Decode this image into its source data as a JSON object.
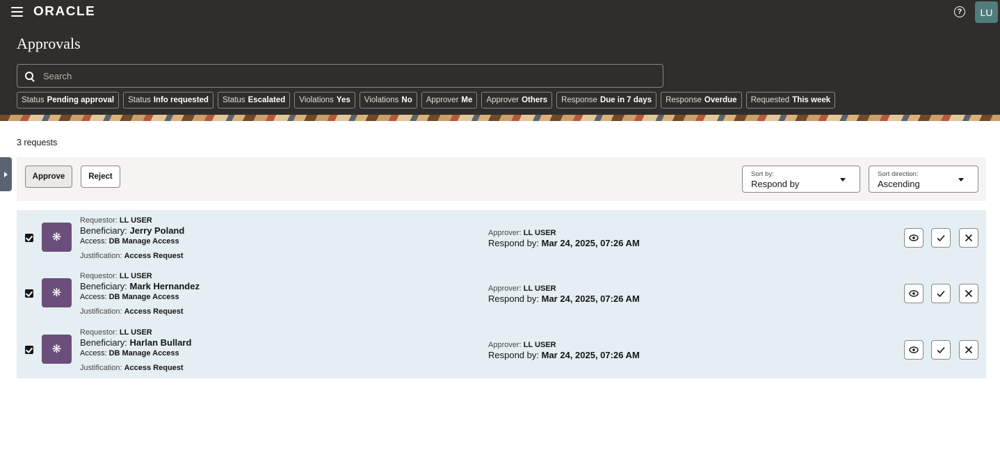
{
  "header": {
    "logo": "ORACLE",
    "avatar_initials": "LU",
    "page_title": "Approvals"
  },
  "search": {
    "placeholder": "Search"
  },
  "filters": [
    {
      "key": "Status",
      "value": "Pending approval"
    },
    {
      "key": "Status",
      "value": "Info requested"
    },
    {
      "key": "Status",
      "value": "Escalated"
    },
    {
      "key": "Violations",
      "value": "Yes"
    },
    {
      "key": "Violations",
      "value": "No"
    },
    {
      "key": "Approver",
      "value": "Me"
    },
    {
      "key": "Approver",
      "value": "Others"
    },
    {
      "key": "Response",
      "value": "Due in 7 days"
    },
    {
      "key": "Response",
      "value": "Overdue"
    },
    {
      "key": "Requested",
      "value": "This week"
    }
  ],
  "results": {
    "count_label": "3 requests"
  },
  "toolbar": {
    "approve_label": "Approve",
    "reject_label": "Reject",
    "sort_by_label": "Sort by:",
    "sort_by_value": "Respond by",
    "sort_direction_label": "Sort direction:",
    "sort_direction_value": "Ascending"
  },
  "labels": {
    "requestor": "Requestor:",
    "beneficiary": "Beneficiary:",
    "access": "Access:",
    "justification": "Justification:",
    "approver": "Approver:",
    "respond_by": "Respond by:"
  },
  "requests": [
    {
      "requestor": "LL USER",
      "beneficiary": "Jerry Poland",
      "access": "DB Manage Access",
      "justification": "Access Request",
      "approver": "LL USER",
      "respond_by": "Mar 24, 2025, 07:26 AM",
      "checked": true
    },
    {
      "requestor": "LL USER",
      "beneficiary": "Mark Hernandez",
      "access": "DB Manage Access",
      "justification": "Access Request",
      "approver": "LL USER",
      "respond_by": "Mar 24, 2025, 07:26 AM",
      "checked": true
    },
    {
      "requestor": "LL USER",
      "beneficiary": "Harlan Bullard",
      "access": "DB Manage Access",
      "justification": "Access Request",
      "approver": "LL USER",
      "respond_by": "Mar 24, 2025, 07:26 AM",
      "checked": true
    }
  ],
  "icons": {
    "menu": "hamburger-menu-icon",
    "help": "help-circle-icon",
    "search": "search-icon",
    "row_tile": "access-bundle-icon",
    "view": "eye-icon",
    "approve": "check-icon",
    "reject": "close-icon"
  }
}
